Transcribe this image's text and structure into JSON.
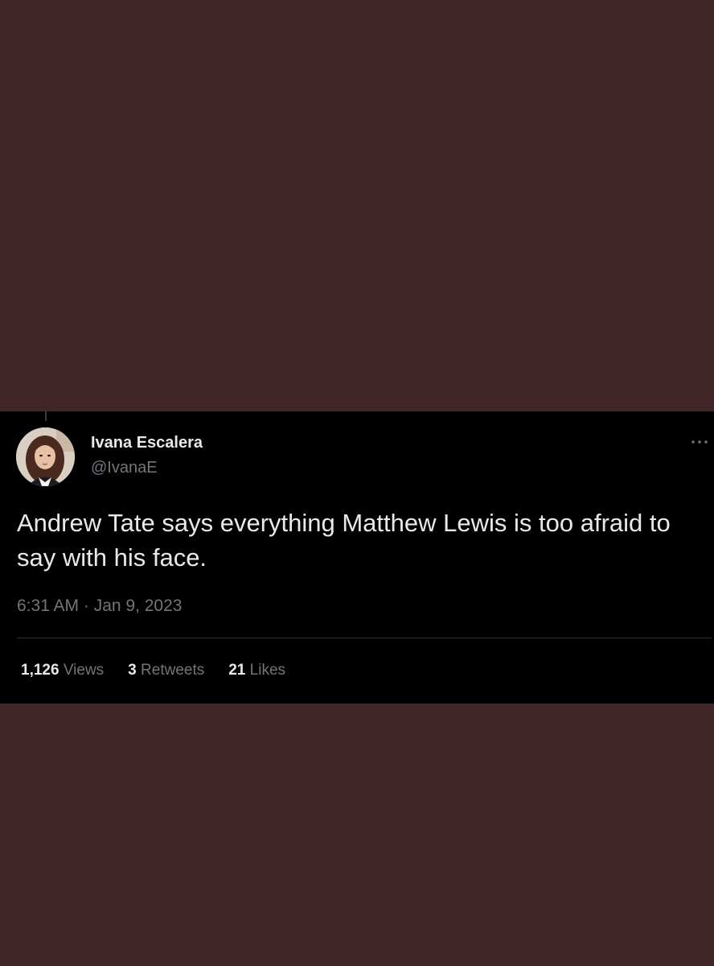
{
  "tweet": {
    "author": {
      "name": "Ivana Escalera",
      "handle": "@IvanaE"
    },
    "text": "Andrew Tate says everything Matthew Lewis is too afraid to say with his face.",
    "timestamp": "6:31 AM · Jan 9, 2023",
    "stats": [
      {
        "count": "1,126",
        "label": "Views"
      },
      {
        "count": "3",
        "label": "Retweets"
      },
      {
        "count": "21",
        "label": "Likes"
      }
    ]
  },
  "colors": {
    "page_background": "#422528",
    "card_background": "#000000",
    "primary_text": "#e7e9ea",
    "secondary_text": "#71767b",
    "divider": "#2f3336"
  },
  "icons": {
    "more": "more-icon"
  }
}
